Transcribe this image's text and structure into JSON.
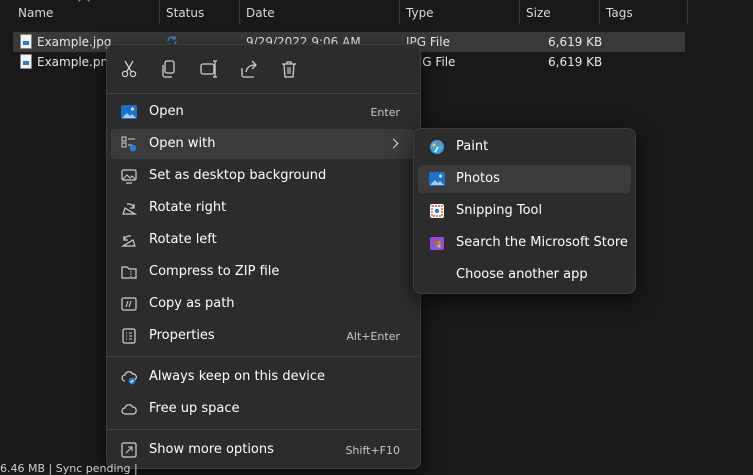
{
  "columns": {
    "name": "Name",
    "status": "Status",
    "date": "Date",
    "type": "Type",
    "size": "Size",
    "tags": "Tags"
  },
  "files": [
    {
      "name": "Example.jpg",
      "status_icon": "sync-icon",
      "date": "9/29/2022 9:06 AM",
      "type": "JPG File",
      "size": "6,619 KB",
      "selected": true
    },
    {
      "name": "Example.png",
      "date": "",
      "type": "PNG File",
      "size": "6,619 KB",
      "selected": false
    }
  ],
  "context_menu": {
    "toolbar": [
      {
        "name": "cut",
        "icon": "scissors-icon"
      },
      {
        "name": "copy",
        "icon": "copy-icon"
      },
      {
        "name": "rename",
        "icon": "rename-icon"
      },
      {
        "name": "share",
        "icon": "share-icon"
      },
      {
        "name": "delete",
        "icon": "trash-icon"
      }
    ],
    "items": [
      {
        "label": "Open",
        "shortcut": "Enter",
        "icon": "photos-icon"
      },
      {
        "label": "Open with",
        "icon": "open-with-icon",
        "submenu": true
      },
      {
        "label": "Set as desktop background",
        "icon": "desktop-icon"
      },
      {
        "label": "Rotate right",
        "icon": "rotate-right-icon"
      },
      {
        "label": "Rotate left",
        "icon": "rotate-left-icon"
      },
      {
        "label": "Compress to ZIP file",
        "icon": "zip-icon"
      },
      {
        "label": "Copy as path",
        "icon": "copy-path-icon"
      },
      {
        "label": "Properties",
        "shortcut": "Alt+Enter",
        "icon": "properties-icon"
      },
      {
        "label": "Always keep on this device",
        "icon": "cloud-keep-icon"
      },
      {
        "label": "Free up space",
        "icon": "cloud-icon"
      },
      {
        "label": "Show more options",
        "shortcut": "Shift+F10",
        "icon": "more-options-icon"
      }
    ]
  },
  "open_with": [
    {
      "label": "Paint",
      "icon": "paint-icon"
    },
    {
      "label": "Photos",
      "icon": "photos-icon"
    },
    {
      "label": "Snipping Tool",
      "icon": "snipping-tool-icon"
    },
    {
      "label": "Search the Microsoft Store",
      "icon": "store-icon"
    },
    {
      "label": "Choose another app"
    }
  ],
  "statusbar": {
    "text": "6.46 MB | Sync pending |"
  },
  "colors": {
    "accent": "#2b7bd6",
    "menu_bg": "#2c2c2c",
    "hover_bg": "#3b3b3b"
  }
}
